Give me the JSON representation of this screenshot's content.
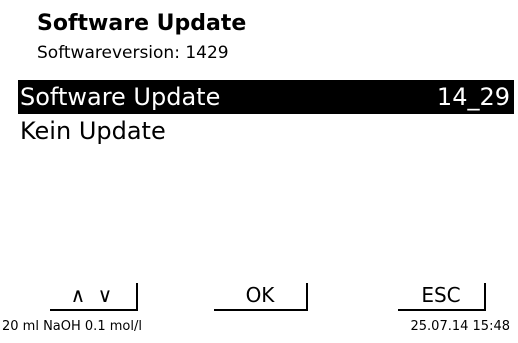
{
  "screen": {
    "title": "Software Update",
    "subtitle": "Softwareversion: 1429"
  },
  "menu": {
    "items": [
      {
        "label": "Software Update",
        "value": "14_29",
        "selected": true
      },
      {
        "label": "Kein Update",
        "value": "",
        "selected": false
      }
    ]
  },
  "softkeys": {
    "nav_label": "∧ ∨",
    "ok_label": "OK",
    "esc_label": "ESC"
  },
  "status": {
    "reagent": "20 ml NaOH 0.1 mol/l",
    "datetime": "25.07.14 15:48"
  },
  "colors": {
    "background": "#ffffff",
    "text": "#000000",
    "selection_background": "#000000",
    "selection_text": "#ffffff"
  }
}
